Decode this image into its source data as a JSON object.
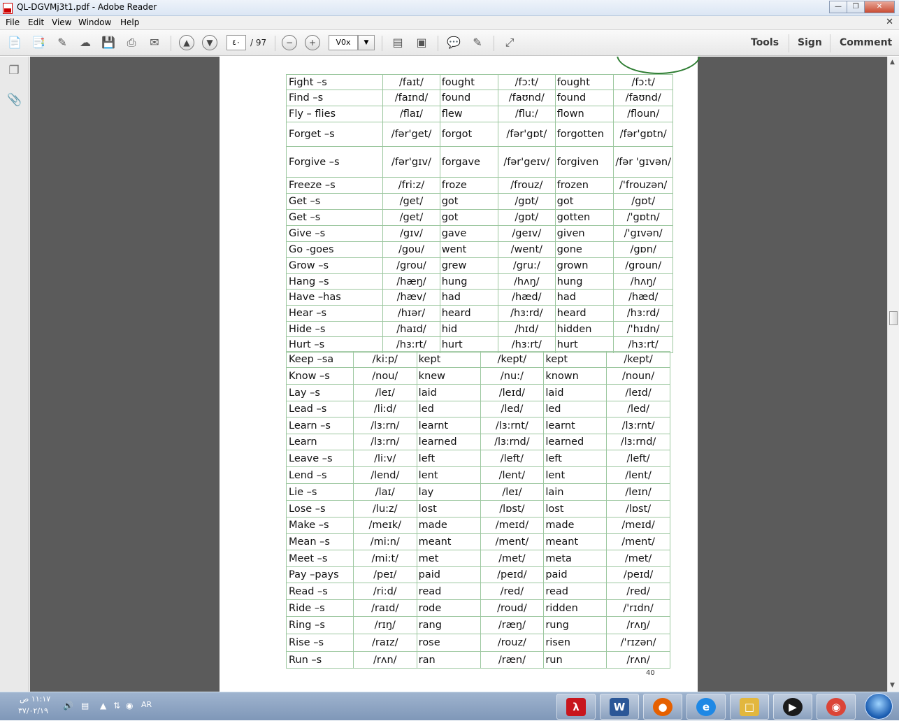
{
  "window": {
    "title": "QL-DGVMj3t1.pdf - Adobe Reader"
  },
  "menu": [
    "File",
    "Edit",
    "View",
    "Window",
    "Help"
  ],
  "toolbar": {
    "current_page": "٤٠",
    "total_pages": "/ 97",
    "zoom": "V0x",
    "links": {
      "tools": "Tools",
      "sign": "Sign",
      "comment": "Comment"
    }
  },
  "document": {
    "page_number": "40",
    "table1": [
      [
        "Fight –s",
        "/faɪt/",
        "fought",
        "/fɔ:t/",
        "fought",
        "/fɔ:t/"
      ],
      [
        "Find –s",
        "/faɪnd/",
        "found",
        "/faʊnd/",
        "found",
        "/faʊnd/"
      ],
      [
        "Fly – flies",
        "/flaɪ/",
        "flew",
        "/flu:/",
        "flown",
        "/floun/"
      ],
      [
        "Forget –s",
        "/fər'get/",
        "forgot",
        "/fər'gɒt/",
        "forgotten",
        "/fər'gɒtn/"
      ],
      [
        "Forgive –s",
        "/fər'gɪv/",
        "forgave",
        "/fər'geɪv/",
        "forgiven",
        "/fər 'gɪvən/"
      ],
      [
        "Freeze –s",
        "/fri:z/",
        "froze",
        "/frouz/",
        "frozen",
        "/'frouzən/"
      ],
      [
        "Get –s",
        "/get/",
        "got",
        "/gɒt/",
        "got",
        "/gɒt/"
      ],
      [
        "Get –s",
        "/get/",
        "got",
        "/gɒt/",
        "gotten",
        "/'gɒtn/"
      ],
      [
        "Give –s",
        "/gɪv/",
        "gave",
        "/geɪv/",
        "given",
        "/'gɪvən/"
      ],
      [
        "Go -goes",
        "/gou/",
        "went",
        "/went/",
        "gone",
        "/gɒn/"
      ],
      [
        "Grow –s",
        "/grou/",
        "grew",
        "/gru:/",
        "grown",
        "/groun/"
      ],
      [
        "Hang –s",
        "/hæŋ/",
        "hung",
        "/hʌŋ/",
        "hung",
        "/hʌŋ/"
      ],
      [
        "Have –has",
        "/hæv/",
        "had",
        "/hæd/",
        "had",
        "/hæd/"
      ],
      [
        "Hear –s",
        "/hɪər/",
        "heard",
        "/hɜ:rd/",
        "heard",
        "/hɜ:rd/"
      ],
      [
        "Hide –s",
        "/haɪd/",
        "hid",
        "/hɪd/",
        "hidden",
        "/'hɪdn/"
      ],
      [
        "Hurt –s",
        "/hɜ:rt/",
        "hurt",
        "/hɜ:rt/",
        "hurt",
        "/hɜ:rt/"
      ]
    ],
    "table2": [
      [
        "Keep –sa",
        "/ki:p/",
        "kept",
        "/kept/",
        "kept",
        "/kept/"
      ],
      [
        "Know –s",
        "/nou/",
        "knew",
        "/nu:/",
        "known",
        "/noun/"
      ],
      [
        "Lay –s",
        "/leɪ/",
        "laid",
        "/leɪd/",
        "laid",
        "/leɪd/"
      ],
      [
        "Lead –s",
        "/li:d/",
        "led",
        "/led/",
        "led",
        "/led/"
      ],
      [
        "Learn  –s",
        "/lɜ:rn/",
        "learnt",
        "/lɜ:rnt/",
        "learnt",
        "/lɜ:rnt/"
      ],
      [
        "Learn",
        "/lɜ:rn/",
        "learned",
        "/lɜ:rnd/",
        "learned",
        "/lɜ:rnd/"
      ],
      [
        "Leave –s",
        "/li:v/",
        "left",
        "/left/",
        "left",
        "/left/"
      ],
      [
        "Lend –s",
        "/lend/",
        "lent",
        "/lent/",
        "lent",
        "/lent/"
      ],
      [
        "Lie –s",
        "/laɪ/",
        "lay",
        "/leɪ/",
        "lain",
        "/leɪn/"
      ],
      [
        "Lose –s",
        "/lu:z/",
        "lost",
        "/lɒst/",
        "lost",
        "/lɒst/"
      ],
      [
        "Make –s",
        "/meɪk/",
        "made",
        "/meɪd/",
        "made",
        "/meɪd/"
      ],
      [
        "Mean –s",
        "/mi:n/",
        "meant",
        "/ment/",
        "meant",
        "/ment/"
      ],
      [
        "Meet –s",
        "/mi:t/",
        "met",
        "/met/",
        "meta",
        "/met/"
      ],
      [
        "Pay –pays",
        "/peɪ/",
        "paid",
        "/peɪd/",
        "paid",
        "/peɪd/"
      ],
      [
        "Read –s",
        "/ri:d/",
        "read",
        "/red/",
        "read",
        "/red/"
      ],
      [
        "Ride –s",
        "/raɪd/",
        "rode",
        "/roud/",
        "ridden",
        "/'rɪdn/"
      ],
      [
        "Ring –s",
        "/rɪŋ/",
        "rang",
        "/ræŋ/",
        "rung",
        "/rʌŋ/"
      ],
      [
        "Rise –s",
        "/raɪz/",
        "rose",
        "/rouz/",
        "risen",
        "/'rɪzən/"
      ],
      [
        "Run –s",
        "/rʌn/",
        "ran",
        "/ræn/",
        "run",
        "/rʌn/"
      ]
    ]
  },
  "taskbar": {
    "time": "١١:١٧ ص",
    "date": "٣٧/٠٢/١٩",
    "language": "AR"
  }
}
